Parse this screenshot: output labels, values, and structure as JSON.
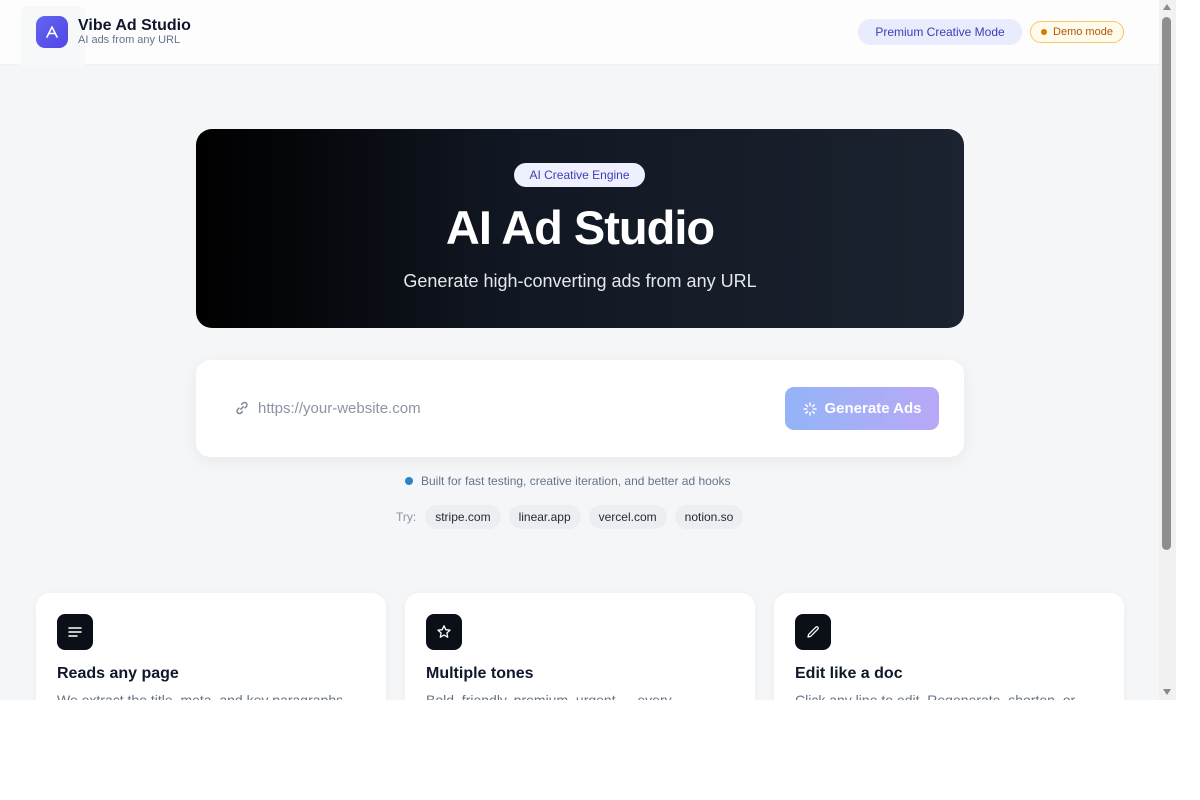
{
  "header": {
    "brand_name": "Vibe Ad Studio",
    "brand_tagline": "AI ads from any URL",
    "premium_pill": "Premium Creative Mode",
    "demo_pill": "Demo mode"
  },
  "hero": {
    "badge": "AI Creative Engine",
    "title": "AI Ad Studio",
    "subtitle": "Generate high-converting ads from any URL"
  },
  "url_form": {
    "input_value": "",
    "input_placeholder": "https://your-website.com",
    "button_label": "Generate Ads",
    "button_state": "loading"
  },
  "hint": "Built for fast testing, creative iteration, and better ad hooks",
  "try": {
    "label": "Try:",
    "examples": [
      "stripe.com",
      "linear.app",
      "vercel.com",
      "notion.so"
    ]
  },
  "features": [
    {
      "icon": "lines-icon",
      "title": "Reads any page",
      "description": "We extract the title, meta, and key paragraphs"
    },
    {
      "icon": "star-icon",
      "title": "Multiple tones",
      "description": "Bold, friendly, premium, urgent — every"
    },
    {
      "icon": "pencil-icon",
      "title": "Edit like a doc",
      "description": "Click any line to edit. Regenerate, shorten, or"
    }
  ],
  "colors": {
    "accent": "#4f46e5",
    "hero_background": "#111722",
    "page_background": "#f5f6f8",
    "demo_pill_border": "#f5c66a",
    "hint_dot": "#2b84c4"
  }
}
